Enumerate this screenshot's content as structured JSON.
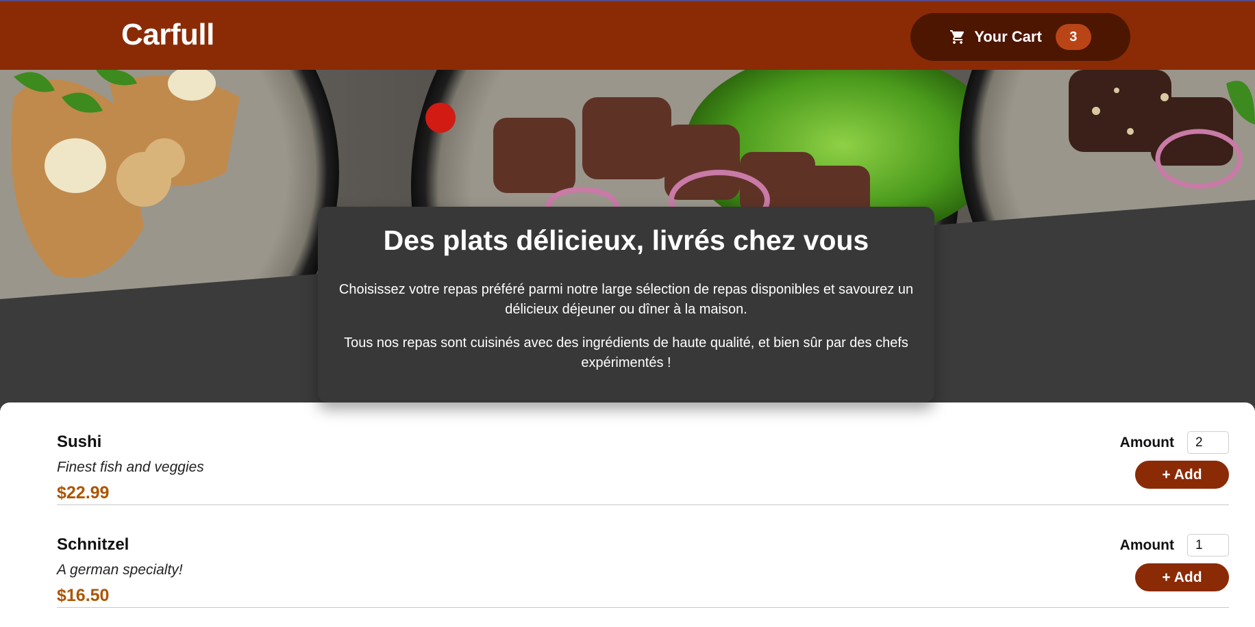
{
  "header": {
    "brand": "Carfull",
    "cart_label": "Your Cart",
    "cart_count": "3",
    "cart_icon": "cart-icon"
  },
  "summary": {
    "title": "Des plats délicieux, livrés chez vous",
    "paragraph1": "Choisissez votre repas préféré parmi notre large sélection de repas disponibles et savourez un délicieux déjeuner ou dîner à la maison.",
    "paragraph2": "Tous nos repas sont cuisinés avec des ingrédients de haute qualité, et bien sûr par des chefs expérimentés !"
  },
  "meals": [
    {
      "name": "Sushi",
      "description": "Finest fish and veggies",
      "price": "$22.99",
      "amount_label": "Amount",
      "amount": "2",
      "add_label": "+ Add"
    },
    {
      "name": "Schnitzel",
      "description": "A german specialty!",
      "price": "$16.50",
      "amount_label": "Amount",
      "amount": "1",
      "add_label": "+ Add"
    }
  ],
  "colors": {
    "header": "#8a2b06",
    "cart_button": "#4d1601",
    "badge": "#b94517",
    "price": "#ad5502",
    "summary_bg": "#383838"
  }
}
